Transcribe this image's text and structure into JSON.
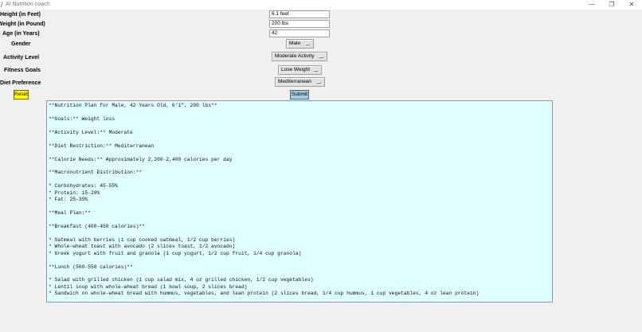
{
  "window": {
    "title": "AI Nutrition coach",
    "minimize": "—",
    "maximize": "❐",
    "close": "✕"
  },
  "form": {
    "height_label": "Height (in Feet)",
    "height_value": "6.1 feet",
    "weight_label": "Weight (in Pound)",
    "weight_value": "200 lbs",
    "age_label": "Age (in Years)",
    "age_value": "42",
    "gender_label": "Gender",
    "gender_value": "Male",
    "activity_label": "Activity Level",
    "activity_value": "Moderate Activity",
    "goals_label": "Fitness Goals",
    "goals_value": "Lose Weight",
    "diet_label": "Diet Preference",
    "diet_value": "Mediterranean"
  },
  "buttons": {
    "reset": "Reset",
    "submit": "Submit"
  },
  "output_lines": [
    "**Nutrition Plan for Male, 42 Years Old, 6'1\", 200 lbs**",
    "",
    "**Goals:** Weight loss",
    "",
    "**Activity Level:** Moderate",
    "",
    "**Diet Restriction:** Mediterranean",
    "",
    "**Calorie Needs:** Approximately 2,200-2,400 calories per day",
    "",
    "**Macronutrient Distribution:**",
    "",
    "* Carbohydrates: 45-55%",
    "* Protein: 15-20%",
    "* Fat: 25-35%",
    "",
    "**Meal Plan:**",
    "",
    "**Breakfast (400-450 calories)**",
    "",
    "* Oatmeal with berries (1 cup cooked oatmeal, 1/2 cup berries)",
    "* Whole-wheat toast with avocado (2 slices toast, 1/2 avocado)",
    "* Greek yogurt with fruit and granola (1 cup yogurt, 1/2 cup fruit, 1/4 cup granola)",
    "",
    "**Lunch (500-550 calories)**",
    "",
    "* Salad with grilled chicken (1 cup salad mix, 4 oz grilled chicken, 1/2 cup vegetables)",
    "* Lentil soup with whole-wheat bread (1 bowl soup, 2 slices bread)",
    "* Sandwich on whole-wheat bread with hummus, vegetables, and lean protein (2 slices bread, 1/4 cup hummus, 1 cup vegetables, 4 oz lean protein)"
  ]
}
